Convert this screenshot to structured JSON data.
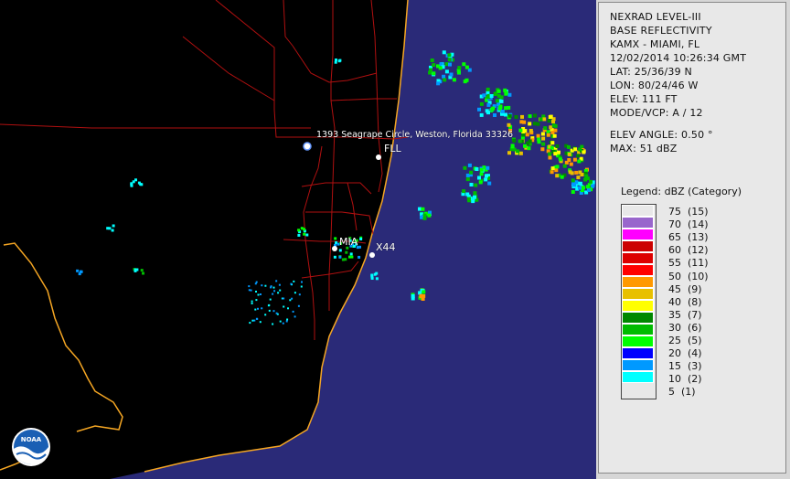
{
  "map": {
    "address_label": "1393 Seagrape Circle, Weston, Florida 33326",
    "places": [
      {
        "label": "FLL"
      },
      {
        "label": "MIA"
      },
      {
        "label": "X44"
      }
    ],
    "logo_text": "NOAA"
  },
  "info": {
    "product": "NEXRAD LEVEL-III",
    "type": "BASE REFLECTIVITY",
    "station": "KAMX - MIAMI, FL",
    "datetime": "12/02/2014 10:26:34 GMT",
    "lat": "LAT: 25/36/39 N",
    "lon": "LON: 80/24/46 W",
    "elev": "ELEV: 111 FT",
    "mode": "MODE/VCP: A / 12",
    "elev_angle": "ELEV ANGLE: 0.50 °",
    "max": "MAX: 51 dBZ"
  },
  "legend": {
    "title": "Legend: dBZ (Category)",
    "items": [
      {
        "label": "75  (15)",
        "color": "#e8e8e8"
      },
      {
        "label": "70  (14)",
        "color": "#9966cc"
      },
      {
        "label": "65  (13)",
        "color": "#ff00ff"
      },
      {
        "label": "60  (12)",
        "color": "#cc0000"
      },
      {
        "label": "55  (11)",
        "color": "#dd0000"
      },
      {
        "label": "50  (10)",
        "color": "#ff0000"
      },
      {
        "label": "45  (9)",
        "color": "#ff9900"
      },
      {
        "label": "40  (8)",
        "color": "#e8c000"
      },
      {
        "label": "35  (7)",
        "color": "#ffff00"
      },
      {
        "label": "30  (6)",
        "color": "#008800"
      },
      {
        "label": "25  (5)",
        "color": "#00bb00"
      },
      {
        "label": "20  (4)",
        "color": "#00ff00"
      },
      {
        "label": "15  (3)",
        "color": "#0000ff"
      },
      {
        "label": "10  (2)",
        "color": "#0099ff"
      },
      {
        "label": "5  (1)",
        "color": "#00ffff"
      }
    ]
  }
}
